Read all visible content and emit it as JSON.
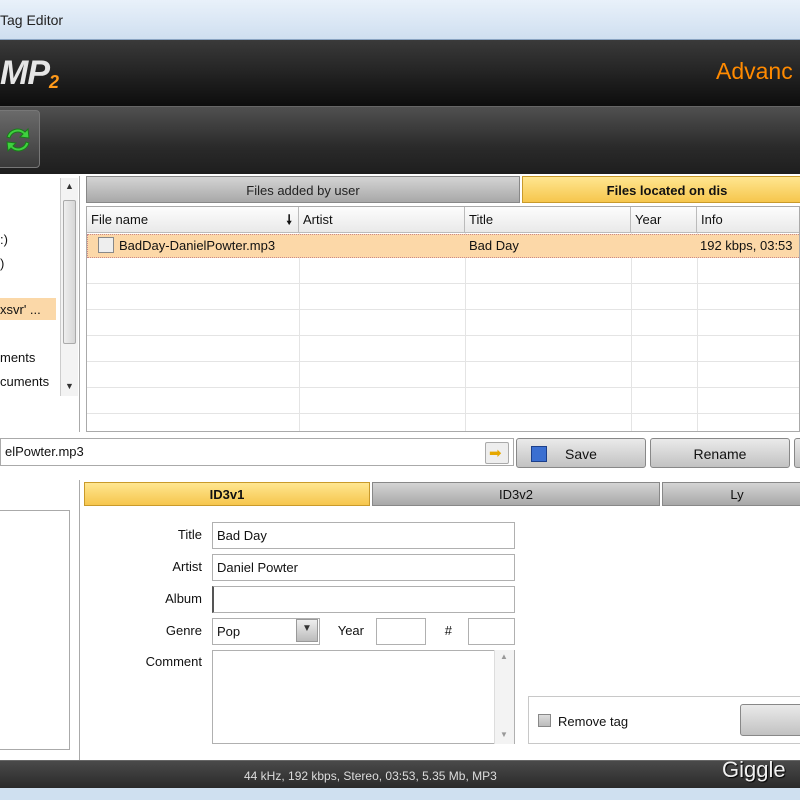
{
  "window": {
    "title": "Tag Editor"
  },
  "header": {
    "logo_text": "MP",
    "logo_sub": "2",
    "brand_text": "Advanc"
  },
  "toolbar": {
    "refresh_icon": "refresh-icon"
  },
  "tree": {
    "items": [
      ":)",
      ")",
      "xsvr' ...",
      "ments",
      "cuments"
    ]
  },
  "file_tabs": {
    "user": "Files added by user",
    "disk": "Files located on dis"
  },
  "grid": {
    "columns": [
      "File name",
      "Artist",
      "Title",
      "Year",
      "Info"
    ],
    "sort_icon": "sort-down-arrow-icon",
    "rows": [
      {
        "file": "BadDay-DanielPowter.mp3",
        "artist": "",
        "title": "Bad Day",
        "year": "",
        "info": "192 kbps, 03:53"
      }
    ]
  },
  "pathbar": {
    "value": "elPowter.mp3"
  },
  "actions": {
    "save": "Save",
    "rename": "Rename"
  },
  "tag_tabs": {
    "id3v1": "ID3v1",
    "id3v2": "ID3v2",
    "lyrics": "Ly"
  },
  "form": {
    "title_label": "Title",
    "title_value": "Bad Day",
    "artist_label": "Artist",
    "artist_value": "Daniel Powter",
    "album_label": "Album",
    "album_value": "",
    "genre_label": "Genre",
    "genre_value": "Pop",
    "year_label": "Year",
    "year_value": "",
    "track_label": "#",
    "track_value": "",
    "comment_label": "Comment",
    "comment_value": ""
  },
  "remove": {
    "label": "Remove tag"
  },
  "status": {
    "text": "44 kHz, 192 kbps, Stereo, 03:53, 5.35 Mb, MP3"
  },
  "watermark": {
    "text": "Giggle"
  },
  "colors": {
    "accent": "#ff8a00",
    "selected_row": "#fcd8a8",
    "active_tab": "#f6c64d"
  }
}
